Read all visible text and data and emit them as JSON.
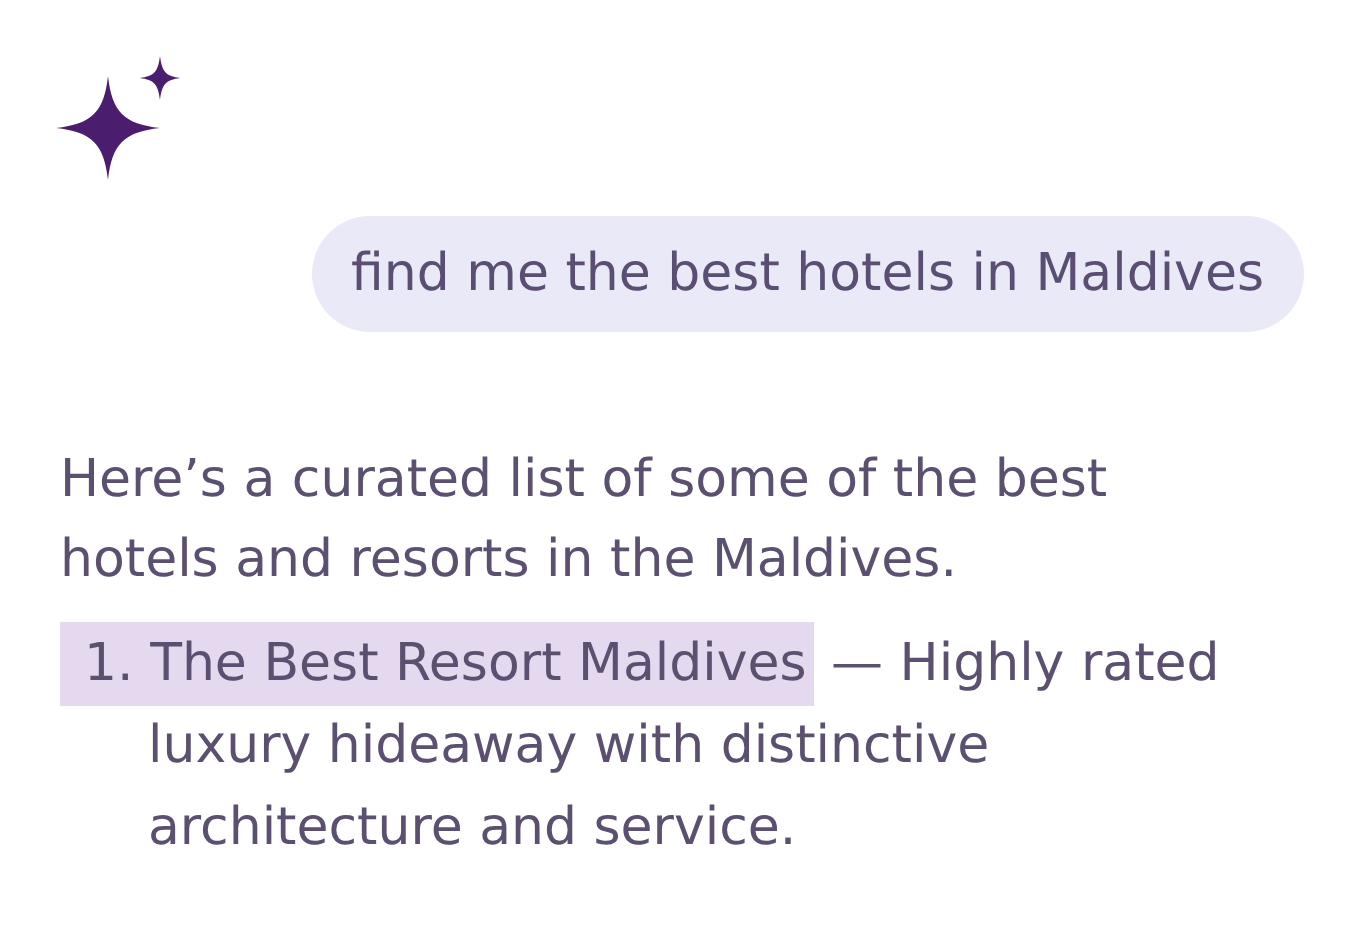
{
  "user_message": {
    "text": "find me the best hotels in Maldives"
  },
  "response": {
    "intro": "Here’s a curated list of some of the best hotels and resorts in the Maldives.",
    "items": [
      {
        "number": "1.",
        "title": "The Best Resort Maldives",
        "description": "— Highly rated luxury hideaway with distinctive architecture and service.",
        "highlighted": true
      }
    ]
  }
}
